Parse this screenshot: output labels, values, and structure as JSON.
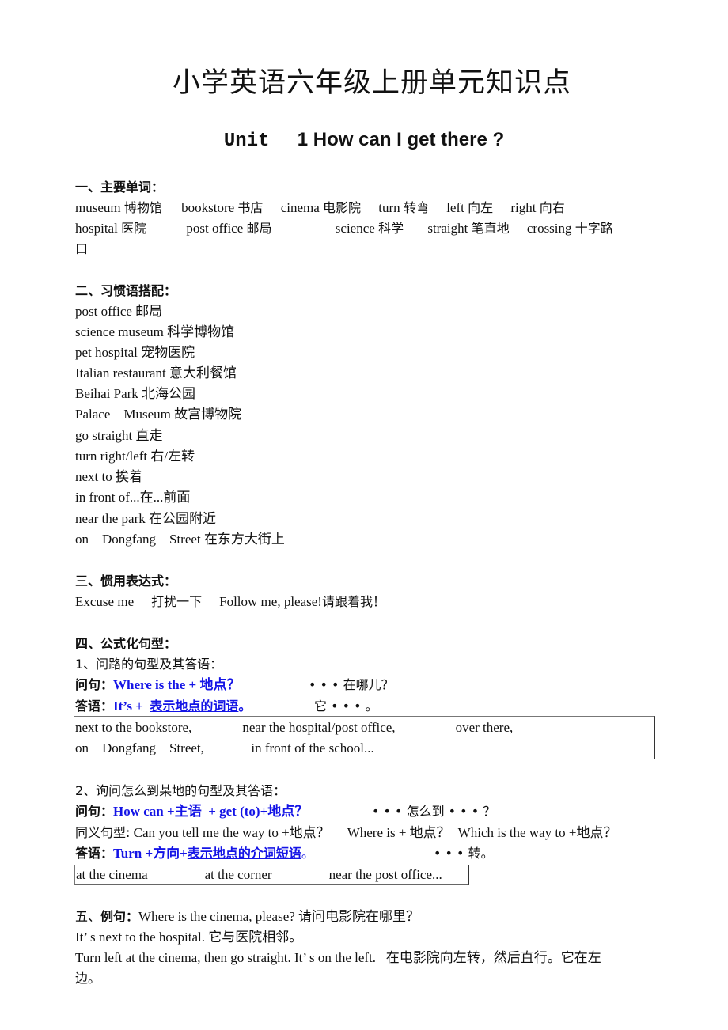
{
  "title": "小学英语六年级上册单元知识点",
  "unit": {
    "prefix": "Unit",
    "number": "1",
    "title": "How can I get there ?"
  },
  "section1": {
    "heading": "一、主要单词：",
    "words": [
      {
        "en": "museum",
        "cn": "博物馆"
      },
      {
        "en": "bookstore",
        "cn": "书店"
      },
      {
        "en": "cinema",
        "cn": "电影院"
      },
      {
        "en": "turn",
        "cn": "转弯"
      },
      {
        "en": "left",
        "cn": "向左"
      },
      {
        "en": "right",
        "cn": "向右"
      },
      {
        "en": "hospital",
        "cn": "医院"
      },
      {
        "en": "post office",
        "cn": "邮局"
      },
      {
        "en": "science",
        "cn": "科学"
      },
      {
        "en": "straight",
        "cn": "笔直地"
      },
      {
        "en": "crossing",
        "cn": "十字路"
      }
    ],
    "wrap": "口"
  },
  "section2": {
    "heading": "二、习惯语搭配：",
    "phrases": [
      "post office 邮局",
      "science museum 科学博物馆",
      "pet hospital 宠物医院",
      "Italian restaurant 意大利餐馆",
      "Beihai Park 北海公园",
      "Palace    Museum 故宫博物院",
      "go straight 直走",
      "turn right/left 右/左转",
      "next to 挨着",
      "in front of...在...前面",
      "near the park 在公园附近",
      "on    Dongfang    Street 在东方大街上"
    ]
  },
  "section3": {
    "heading": "三、惯用表达式：",
    "items": [
      {
        "en": "Excuse me",
        "cn": "打扰一下"
      },
      {
        "en": "Follow me, please!",
        "cn": "请跟着我！"
      }
    ]
  },
  "section4": {
    "heading": "四、公式化句型：",
    "part1": {
      "title": "1、问路的句型及其答语：",
      "question_label": "问句：",
      "question": "Where is the +  地点？",
      "question_cn": "• • • 在哪儿？",
      "answer_label": "答语：",
      "answer_prefix": "It’s +  ",
      "answer_underlined": "表示地点的词语",
      "answer_end": "。",
      "answer_cn": "它 • • • 。",
      "box_row1": [
        "next to the bookstore,",
        "near the hospital/post office,",
        "over there,"
      ],
      "box_row2": [
        "on    Dongfang    Street,",
        "in front of the school..."
      ]
    },
    "part2": {
      "title": "2、询问怎么到某地的句型及其答语：",
      "question_label": "问句：",
      "question": "How can +主语  + get (to)+地点？",
      "question_cn": "• • • 怎么到 • • • ？",
      "synonym_label": "同义句型:",
      "synonyms": [
        "Can you tell me the way to +地点？",
        "Where is +  地点？",
        "Which is the way to +地点？"
      ],
      "answer_label": "答语：",
      "answer_prefix": "Turn +方向+",
      "answer_underlined": "表示地点的介词短语",
      "answer_end": "。",
      "answer_cn": "• • • 转。",
      "box_items": [
        "at the cinema",
        "at the corner",
        "near the post office..."
      ]
    }
  },
  "section5": {
    "heading_num": "五、",
    "heading": "例句：",
    "lines": [
      "Where is the cinema, please? 请问电影院在哪里？",
      "It’ s next to the hospital. 它与医院相邻。",
      "Turn left at the cinema, then go straight. It’ s on the left.   在电影院向左转，然后直行。它在左",
      "边。"
    ]
  }
}
